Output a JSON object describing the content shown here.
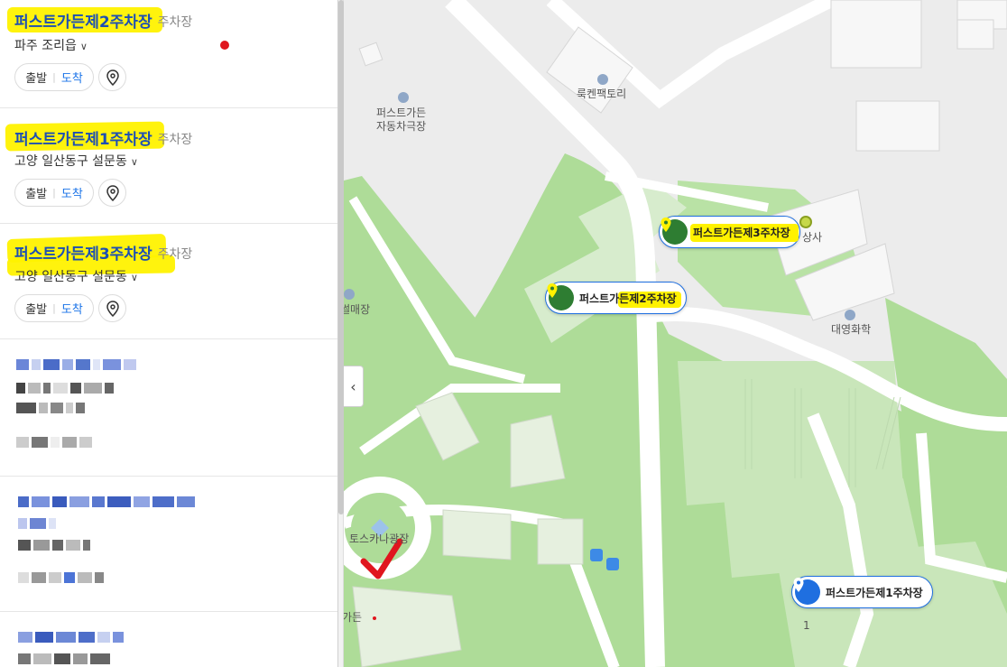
{
  "results": [
    {
      "name": "퍼스트가든제2주차장",
      "category": "주차장",
      "address": "파주 조리읍",
      "depart_label": "출발",
      "arrive_label": "도착"
    },
    {
      "name": "퍼스트가든제1주차장",
      "category": "주차장",
      "address": "고양 일산동구 설문동",
      "depart_label": "출발",
      "arrive_label": "도착"
    },
    {
      "name": "퍼스트가든제3주차장",
      "category": "주차장",
      "address": "고양 일산동구 설문동",
      "depart_label": "출발",
      "arrive_label": "도착"
    }
  ],
  "map": {
    "labels": {
      "rookenpack": "룩켄팩토리",
      "theater_line1": "퍼스트가든",
      "theater_line2": "자동차극장",
      "sangsa": "상사",
      "seolmaejang": "썰매장",
      "daeyoung": "대영화학",
      "toscana": "토스카나광장",
      "garden": "가든",
      "stop_1": "1"
    },
    "markers": [
      {
        "label": "퍼스트가든제3주차장",
        "color": "#2e7d32"
      },
      {
        "label": "퍼스트가든제2주차장",
        "color": "#2e7d32"
      },
      {
        "label": "퍼스트가든제1주차장",
        "color": "#1f6fe0"
      }
    ],
    "collapse_icon": "chevron-left-icon"
  },
  "colors": {
    "accent": "#1f6fe0",
    "highlight": "#fff200",
    "park_green": "#aedc98",
    "annotation_red": "#e0161e"
  }
}
